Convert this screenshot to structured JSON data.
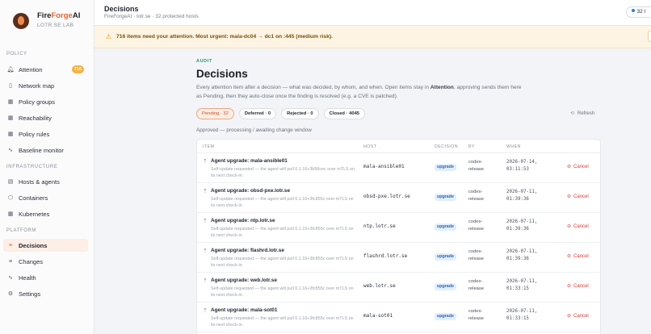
{
  "brand": {
    "name_part1": "Fire",
    "name_part2": "Forge",
    "name_part3": "AI",
    "sub": "LOTR.SE LAB"
  },
  "sidebar": {
    "sections": {
      "policy": "POLICY",
      "infrastructure": "INFRASTRUCTURE",
      "platform": "PLATFORM"
    },
    "items": [
      {
        "label": "Attention",
        "icon": "bell-icon",
        "badge": "716"
      },
      {
        "label": "Network map",
        "icon": "map-icon"
      },
      {
        "label": "Policy groups",
        "icon": "grid-icon"
      },
      {
        "label": "Reachability",
        "icon": "grid-icon"
      },
      {
        "label": "Policy rules",
        "icon": "grid-icon"
      },
      {
        "label": "Baseline monitor",
        "icon": "pulse-icon"
      },
      {
        "label": "Hosts & agents",
        "icon": "server-icon"
      },
      {
        "label": "Containers",
        "icon": "box-icon"
      },
      {
        "label": "Kubernetes",
        "icon": "grid-icon"
      },
      {
        "label": "Decisions",
        "icon": "list-icon",
        "active": true
      },
      {
        "label": "Changes",
        "icon": "list-icon"
      },
      {
        "label": "Health",
        "icon": "pulse-icon"
      },
      {
        "label": "Settings",
        "icon": "gear-icon"
      }
    ]
  },
  "header": {
    "title": "Decisions",
    "subtitle": "FireForgeAI · lotr.se · 32 protected hosts",
    "pill": "32 l"
  },
  "alert": {
    "text": "716 items need your attention. Most urgent: mala-dc04 → dc1 on :445 (medium risk)."
  },
  "main": {
    "kicker": "AUDIT",
    "title": "Decisions",
    "desc_part1": "Every attention item after a decision — what was decided, by whom, and when. Open items stay in ",
    "desc_bold": "Attention",
    "desc_part2": "; approving sends them here as Pending, then they auto-close once the finding is resolved (e.g. a CVE is patched).",
    "tabs": [
      "Pending · 32",
      "Deferred · 0",
      "Rejected · 0",
      "Closed · 4045"
    ],
    "refresh": "Refresh",
    "status_line": "Approved — processing / awaiting change window"
  },
  "table": {
    "headers": {
      "item": "ITEM",
      "host": "HOST",
      "decision": "DECISION",
      "by": "BY",
      "when": "WHEN"
    },
    "rows": [
      {
        "title": "Agent upgrade: mala-ansible01",
        "desc": "Self-update requested — the agent will pull 0.1.16+3b56cec over mTLS on its next check-in.",
        "host": "mala-ansible01",
        "decision": "upgrade",
        "by": "codex-release",
        "when": "2026-07-14, 03:11:53",
        "action": "Cancel"
      },
      {
        "title": "Agent upgrade: obsd-pxe.lotr.se",
        "desc": "Self-update requested — the agent will pull 0.1.16+3fc855c over mTLS on its next check-in.",
        "host": "obsd-pxe.lotr.se",
        "decision": "upgrade",
        "by": "codex-release",
        "when": "2026-07-11, 01:39:36",
        "action": "Cancel"
      },
      {
        "title": "Agent upgrade: ntp.lotr.se",
        "desc": "Self-update requested — the agent will pull 0.1.16+3fc855c over mTLS on its next check-in.",
        "host": "ntp.lotr.se",
        "decision": "upgrade",
        "by": "codex-release",
        "when": "2026-07-11, 01:39:36",
        "action": "Cancel"
      },
      {
        "title": "Agent upgrade: flashrd.lotr.se",
        "desc": "Self-update requested — the agent will pull 0.1.16+3fc855c over mTLS on its next check-in.",
        "host": "flashrd.lotr.se",
        "decision": "upgrade",
        "by": "codex-release",
        "when": "2026-07-11, 01:39:36",
        "action": "Cancel"
      },
      {
        "title": "Agent upgrade: web.lotr.se",
        "desc": "Self-update requested — the agent will pull 0.1.16+3fc855c over mTLS on its next check-in.",
        "host": "web.lotr.se",
        "decision": "upgrade",
        "by": "codex-release",
        "when": "2026-07-11, 01:33:15",
        "action": "Cancel"
      },
      {
        "title": "Agent upgrade: mala-sot01",
        "desc": "Self-update requested — the agent will pull 0.1.16+3fc855c over mTLS on its next check-in.",
        "host": "mala-sot01",
        "decision": "upgrade",
        "by": "codex-release",
        "when": "2026-07-11, 01:33:15",
        "action": "Cancel"
      }
    ]
  }
}
